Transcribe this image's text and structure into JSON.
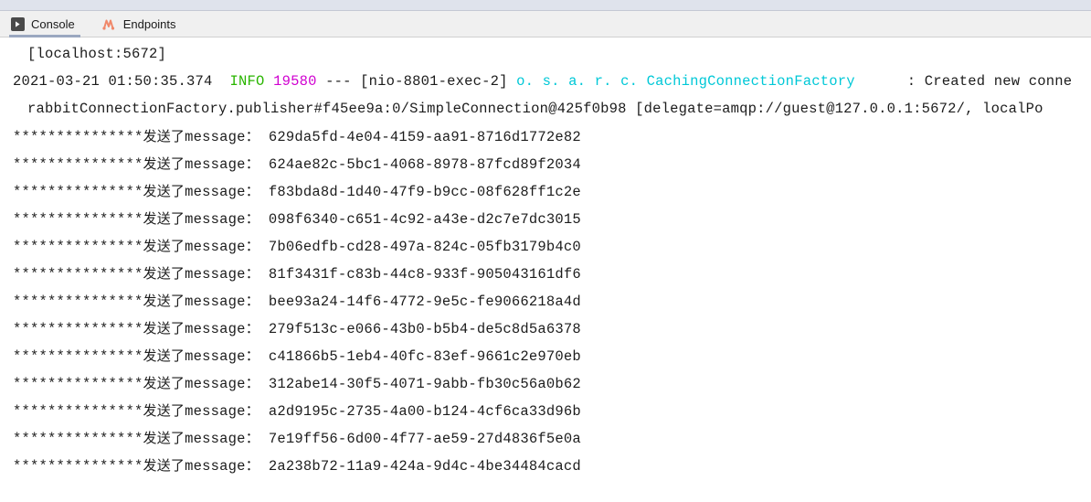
{
  "window": {
    "top_strip_color": "#dfe3ec",
    "tabbar_color": "#f0f0f0",
    "active_tab_indicator_color": "#9aa7c0"
  },
  "tabs": [
    {
      "label": "Console",
      "icon": "console-run-icon",
      "active": true
    },
    {
      "label": "Endpoints",
      "icon": "endpoints-chart-icon",
      "active": false
    }
  ],
  "console": {
    "colors": {
      "level_info": "#29b500",
      "pid": "#d000d0",
      "logger": "#00c8d7",
      "text": "#1c1c1c"
    },
    "lines": [
      {
        "id": "line-host",
        "indent": true,
        "segments": [
          {
            "text": "[localhost:5672]",
            "style": "plain"
          }
        ]
      },
      {
        "id": "line-startup",
        "indent": false,
        "segments": [
          {
            "text": "2021-03-21 01:50:35.374  ",
            "style": "plain"
          },
          {
            "text": "INFO",
            "style": "level"
          },
          {
            "text": " ",
            "style": "plain"
          },
          {
            "text": "19580",
            "style": "pid"
          },
          {
            "text": " --- [nio-8801-exec-2] ",
            "style": "plain"
          },
          {
            "text": "o. s. a. r. c. CachingConnectionFactory",
            "style": "logger"
          },
          {
            "text": "      : Created new conne",
            "style": "plain"
          }
        ]
      },
      {
        "id": "line-delegate",
        "indent": true,
        "segments": [
          {
            "text": "rabbitConnectionFactory.publisher#f45ee9a:0/SimpleConnection@425f0b98 [delegate=amqp://guest@127.0.0.1:5672/, localPo",
            "style": "plain"
          }
        ]
      },
      {
        "id": "msg-1",
        "indent": false,
        "message": {
          "stars": "***************",
          "cjk": "发送了",
          "label": "message：",
          "uuid": "629da5fd-4e04-4159-aa91-8716d1772e82"
        }
      },
      {
        "id": "msg-2",
        "indent": false,
        "message": {
          "stars": "***************",
          "cjk": "发送了",
          "label": "message：",
          "uuid": "624ae82c-5bc1-4068-8978-87fcd89f2034"
        }
      },
      {
        "id": "msg-3",
        "indent": false,
        "message": {
          "stars": "***************",
          "cjk": "发送了",
          "label": "message：",
          "uuid": "f83bda8d-1d40-47f9-b9cc-08f628ff1c2e"
        }
      },
      {
        "id": "msg-4",
        "indent": false,
        "message": {
          "stars": "***************",
          "cjk": "发送了",
          "label": "message：",
          "uuid": "098f6340-c651-4c92-a43e-d2c7e7dc3015"
        }
      },
      {
        "id": "msg-5",
        "indent": false,
        "message": {
          "stars": "***************",
          "cjk": "发送了",
          "label": "message：",
          "uuid": "7b06edfb-cd28-497a-824c-05fb3179b4c0"
        }
      },
      {
        "id": "msg-6",
        "indent": false,
        "message": {
          "stars": "***************",
          "cjk": "发送了",
          "label": "message：",
          "uuid": "81f3431f-c83b-44c8-933f-905043161df6"
        }
      },
      {
        "id": "msg-7",
        "indent": false,
        "message": {
          "stars": "***************",
          "cjk": "发送了",
          "label": "message：",
          "uuid": "bee93a24-14f6-4772-9e5c-fe9066218a4d"
        }
      },
      {
        "id": "msg-8",
        "indent": false,
        "message": {
          "stars": "***************",
          "cjk": "发送了",
          "label": "message：",
          "uuid": "279f513c-e066-43b0-b5b4-de5c8d5a6378"
        }
      },
      {
        "id": "msg-9",
        "indent": false,
        "message": {
          "stars": "***************",
          "cjk": "发送了",
          "label": "message：",
          "uuid": "c41866b5-1eb4-40fc-83ef-9661c2e970eb"
        }
      },
      {
        "id": "msg-10",
        "indent": false,
        "message": {
          "stars": "***************",
          "cjk": "发送了",
          "label": "message：",
          "uuid": "312abe14-30f5-4071-9abb-fb30c56a0b62"
        }
      },
      {
        "id": "msg-11",
        "indent": false,
        "message": {
          "stars": "***************",
          "cjk": "发送了",
          "label": "message：",
          "uuid": "a2d9195c-2735-4a00-b124-4cf6ca33d96b"
        }
      },
      {
        "id": "msg-12",
        "indent": false,
        "message": {
          "stars": "***************",
          "cjk": "发送了",
          "label": "message：",
          "uuid": "7e19ff56-6d00-4f77-ae59-27d4836f5e0a"
        }
      },
      {
        "id": "msg-13",
        "indent": false,
        "message": {
          "stars": "***************",
          "cjk": "发送了",
          "label": "message：",
          "uuid": "2a238b72-11a9-424a-9d4c-4be34484cacd"
        }
      }
    ]
  }
}
